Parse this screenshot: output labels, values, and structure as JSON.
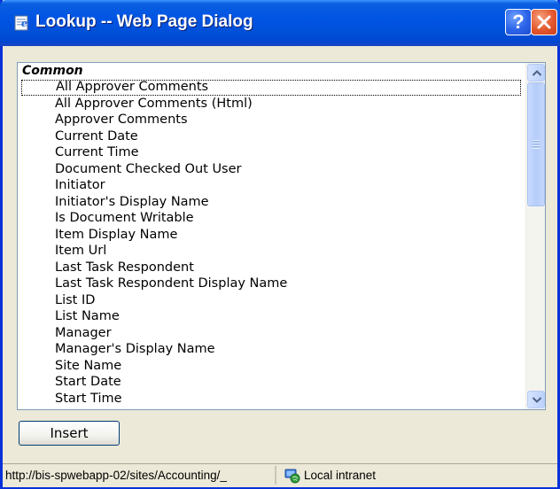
{
  "window": {
    "title": "Lookup -- Web Page Dialog",
    "help_label": "?"
  },
  "list": {
    "group_label": "Common",
    "items": [
      "All Approver Comments",
      "All Approver Comments (Html)",
      "Approver Comments",
      "Current Date",
      "Current Time",
      "Document Checked Out User",
      "Initiator",
      "Initiator's Display Name",
      "Is Document Writable",
      "Item Display Name",
      "Item Url",
      "Last Task Respondent",
      "Last Task Respondent Display Name",
      "List ID",
      "List Name",
      "Manager",
      "Manager's Display Name",
      "Site Name",
      "Start Date",
      "Start Time"
    ],
    "focused_item": "All Approver Comments"
  },
  "buttons": {
    "insert_label": "Insert"
  },
  "statusbar": {
    "url": "http://bis-spwebapp-02/sites/Accounting/_",
    "zone": "Local intranet"
  },
  "colors": {
    "titlebar": "#0054e3",
    "window_bg": "#ece9d8",
    "close_button": "#e4572e",
    "help_button": "#2b63e8"
  }
}
